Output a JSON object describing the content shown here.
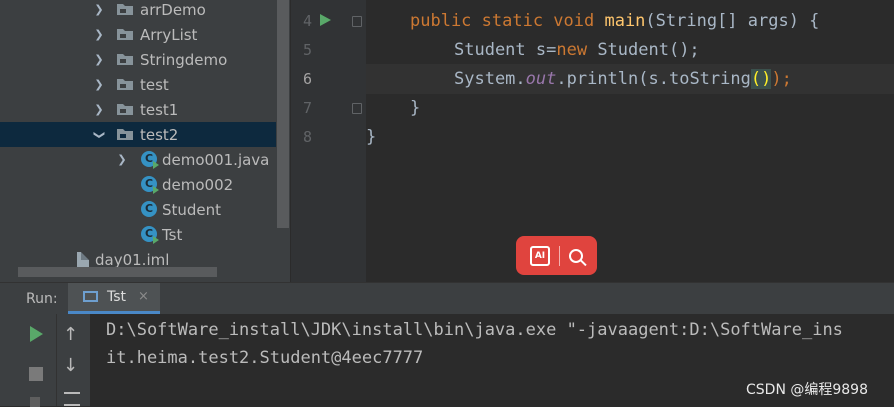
{
  "project_tree": {
    "items": [
      {
        "label": "arrDemo",
        "kind": "folder",
        "expanded": false
      },
      {
        "label": "ArryList",
        "kind": "folder",
        "expanded": false
      },
      {
        "label": "Stringdemo",
        "kind": "folder",
        "expanded": false
      },
      {
        "label": "test",
        "kind": "folder",
        "expanded": false
      },
      {
        "label": "test1",
        "kind": "folder",
        "expanded": false
      },
      {
        "label": "test2",
        "kind": "folder",
        "expanded": true,
        "selected": true
      },
      {
        "label": "demo001.java",
        "kind": "java-class",
        "expanded": false
      },
      {
        "label": "demo002",
        "kind": "java-class"
      },
      {
        "label": "Student",
        "kind": "java-class"
      },
      {
        "label": "Tst",
        "kind": "java-class"
      },
      {
        "label": "day01.iml",
        "kind": "iml-file"
      }
    ]
  },
  "editor": {
    "line_numbers": [
      "4",
      "5",
      "6",
      "7",
      "8"
    ],
    "current_line": "6",
    "code": {
      "l4_kw": "public static void ",
      "l4_fn": "main",
      "l4_rest": "(String[] args) {",
      "l5_a": "Student s=",
      "l5_kw": "new",
      "l5_b": " Student();",
      "l6_a": "System.",
      "l6_out": "out",
      "l6_b": ".println(s.",
      "l6_call": "toString",
      "l6_paren": "()",
      "l6_c": ");",
      "l7": "}",
      "l8": "}"
    }
  },
  "floating_toolbar": {
    "ai_label": "AI",
    "icons": [
      "ai-text-icon",
      "search-icon"
    ],
    "color": "#e0443e"
  },
  "run_panel": {
    "title": "Run:",
    "tab_label": "Tst",
    "tab_close": "×",
    "output": [
      "D:\\SoftWare_install\\JDK\\install\\bin\\java.exe \"-javaagent:D:\\SoftWare_ins",
      "it.heima.test2.Student@4eec7777"
    ]
  },
  "watermark": "CSDN @编程9898",
  "colors": {
    "keyword": "#cc7832",
    "method": "#ffc66d",
    "static_field": "#9876aa",
    "run_green": "#59a869",
    "selection": "#0d293e"
  }
}
